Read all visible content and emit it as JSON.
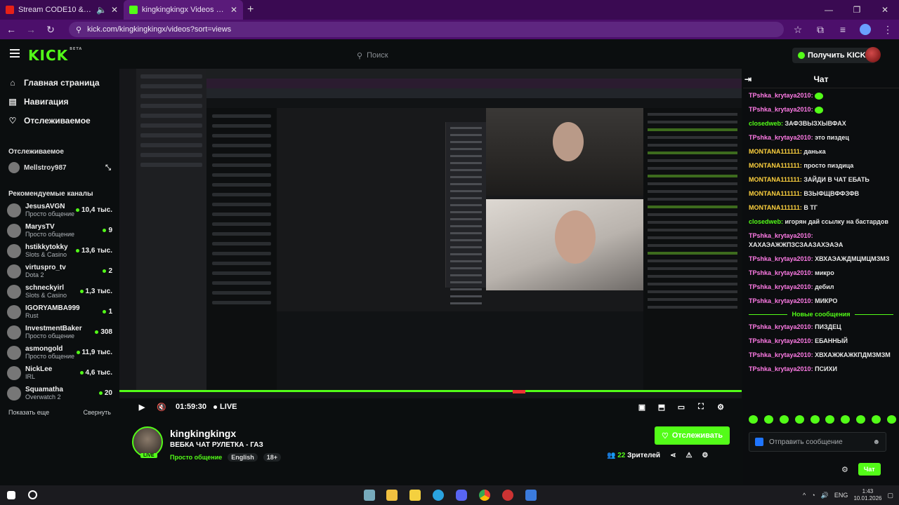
{
  "browser": {
    "tabs": [
      {
        "title": "Stream CODE10 & RILEY 8А",
        "active": false
      },
      {
        "title": "kingkingkingx Videos - Watch",
        "active": true
      }
    ],
    "url": "kick.com/kingkingkingx/videos?sort=views"
  },
  "header": {
    "logo": "KICK",
    "logo_beta": "BETA",
    "search_placeholder": "Поиск",
    "get_kicks": "Получить KICKs"
  },
  "sidebar": {
    "nav": [
      {
        "label": "Главная страница",
        "icon": "home-icon"
      },
      {
        "label": "Навигация",
        "icon": "browse-icon"
      },
      {
        "label": "Отслеживаемое",
        "icon": "heart-icon"
      }
    ],
    "following_heading": "Отслеживаемое",
    "following": [
      {
        "name": "Mellstroy987"
      }
    ],
    "recommended_heading": "Рекомендуемые каналы",
    "channels": [
      {
        "name": "JesusAVGN",
        "category": "Просто общение",
        "viewers": "10,4 тыс."
      },
      {
        "name": "MarysTV",
        "category": "Просто общение",
        "viewers": "9"
      },
      {
        "name": "hstikkytokky",
        "category": "Slots & Casino",
        "viewers": "13,6 тыс."
      },
      {
        "name": "virtuspro_tv",
        "category": "Dota 2",
        "viewers": "2"
      },
      {
        "name": "schneckyirl",
        "category": "Slots & Casino",
        "viewers": "1,3 тыс."
      },
      {
        "name": "IGORYAMBA999",
        "category": "Rust",
        "viewers": "1"
      },
      {
        "name": "InvestmentBaker",
        "category": "Просто общение",
        "viewers": "308"
      },
      {
        "name": "asmongold",
        "category": "Просто общение",
        "viewers": "11,9 тыс."
      },
      {
        "name": "NickLee",
        "category": "IRL",
        "viewers": "4,6 тыс."
      },
      {
        "name": "Squamatha",
        "category": "Overwatch 2",
        "viewers": "20"
      }
    ],
    "show_more": "Показать еще",
    "collapse": "Свернуть"
  },
  "player": {
    "time": "01:59:30",
    "live": "LIVE"
  },
  "stream": {
    "name": "kingkingkingx",
    "title": "ВЕБКА ЧАТ РУЛЕТКА - ГАЗ",
    "category": "Просто общение",
    "tags": [
      "English",
      "18+"
    ],
    "follow": "Отслеживать",
    "viewers_count": "22",
    "viewers_label": "Зрителей",
    "live_badge": "LIVE"
  },
  "chat": {
    "title": "Чат",
    "messages": [
      {
        "user": "TPshka_krytaya2010",
        "color": "#ff7be6",
        "text": "",
        "emote": true
      },
      {
        "user": "TPshka_krytaya2010",
        "color": "#ff7be6",
        "text": "",
        "emote": true
      },
      {
        "user": "closedweb",
        "color": "#53fc18",
        "text": "ЗАФЗВЫЗХЫВФАХ"
      },
      {
        "user": "TPshka_krytaya2010",
        "color": "#ff7be6",
        "text": "это пиздец"
      },
      {
        "user": "MONTANA111111",
        "color": "#ffd23e",
        "text": "данька"
      },
      {
        "user": "MONTANA111111",
        "color": "#ffd23e",
        "text": "просто пиздица"
      },
      {
        "user": "MONTANA111111",
        "color": "#ffd23e",
        "text": "ЗАЙДИ В ЧАТ ЕБАТЬ"
      },
      {
        "user": "MONTANA111111",
        "color": "#ffd23e",
        "text": "ВЗЫФЩВФФЗФВ"
      },
      {
        "user": "MONTANA111111",
        "color": "#ffd23e",
        "text": "В ТГ"
      },
      {
        "user": "closedweb",
        "color": "#53fc18",
        "text": "игорян дай ссылку на бастардов"
      },
      {
        "user": "TPshka_krytaya2010",
        "color": "#ff7be6",
        "text": "ХАХАЭАЖЖПЗСЗААЗАХЭАЭА"
      },
      {
        "user": "TPshka_krytaya2010",
        "color": "#ff7be6",
        "text": "ХВХАЭАЖДМЦМЦМЗМЗ"
      },
      {
        "user": "TPshka_krytaya2010",
        "color": "#ff7be6",
        "text": "микро"
      },
      {
        "user": "TPshka_krytaya2010",
        "color": "#ff7be6",
        "text": "дебил"
      },
      {
        "user": "TPshka_krytaya2010",
        "color": "#ff7be6",
        "text": "МИКРО"
      }
    ],
    "new_messages_label": "Новые сообщения",
    "new_messages": [
      {
        "user": "TPshka_krytaya2010",
        "color": "#ff7be6",
        "text": "ПИЗДЕЦ"
      },
      {
        "user": "TPshka_krytaya2010",
        "color": "#ff7be6",
        "text": "ЕБАННЫЙ"
      },
      {
        "user": "TPshka_krytaya2010",
        "color": "#ff7be6",
        "text": "ХВХАЖЖАЖКПДМЗМЗМ"
      },
      {
        "user": "TPshka_krytaya2010",
        "color": "#ff7be6",
        "text": "ПСИХИ"
      }
    ],
    "input_placeholder": "Отправить сообщение",
    "send_label": "Чат"
  },
  "taskbar": {
    "lang": "ENG",
    "time": "1:43",
    "date": "10.01.2026"
  },
  "colors": {
    "accent": "#53fc18",
    "browser_frame": "#4c0f6b"
  }
}
